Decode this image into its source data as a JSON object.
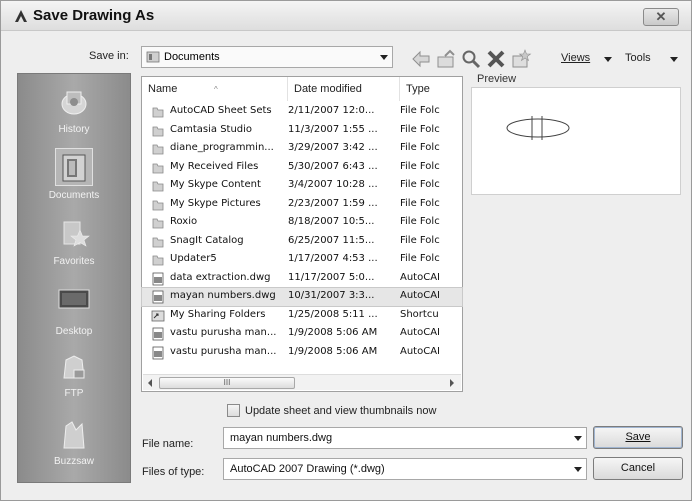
{
  "window": {
    "title": "Save Drawing As",
    "close_icon": "close-icon"
  },
  "toolbar": {
    "save_in_label": "Save in:",
    "save_in_value": "Documents",
    "icons": [
      "back-arrow-icon",
      "up-folder-icon",
      "search-icon",
      "delete-icon",
      "new-folder-icon"
    ],
    "views_label": "Views",
    "tools_label": "Tools"
  },
  "places": [
    {
      "label": "History",
      "icon": "history-icon"
    },
    {
      "label": "Documents",
      "icon": "documents-icon"
    },
    {
      "label": "Favorites",
      "icon": "favorites-icon"
    },
    {
      "label": "Desktop",
      "icon": "desktop-icon"
    },
    {
      "label": "FTP",
      "icon": "ftp-icon"
    },
    {
      "label": "Buzzsaw",
      "icon": "buzzsaw-icon"
    }
  ],
  "filelist": {
    "columns": [
      "Name",
      "Date modified",
      "Type"
    ],
    "rows": [
      {
        "name": "AutoCAD Sheet Sets",
        "date": "2/11/2007 12:0...",
        "type": "File Folc",
        "icon": "folder-icon"
      },
      {
        "name": "Camtasia Studio",
        "date": "11/3/2007 1:55 ...",
        "type": "File Folc",
        "icon": "folder-icon"
      },
      {
        "name": "diane_programmin...",
        "date": "3/29/2007 3:42 ...",
        "type": "File Folc",
        "icon": "folder-icon"
      },
      {
        "name": "My Received Files",
        "date": "5/30/2007 6:43 ...",
        "type": "File Folc",
        "icon": "folder-icon"
      },
      {
        "name": "My Skype Content",
        "date": "3/4/2007 10:28 ...",
        "type": "File Folc",
        "icon": "folder-icon"
      },
      {
        "name": "My Skype Pictures",
        "date": "2/23/2007 1:59 ...",
        "type": "File Folc",
        "icon": "folder-icon"
      },
      {
        "name": "Roxio",
        "date": "8/18/2007 10:5...",
        "type": "File Folc",
        "icon": "folder-icon"
      },
      {
        "name": "SnagIt Catalog",
        "date": "6/25/2007 11:5...",
        "type": "File Folc",
        "icon": "folder-icon"
      },
      {
        "name": "Updater5",
        "date": "1/17/2007 4:53 ...",
        "type": "File Folc",
        "icon": "folder-icon"
      },
      {
        "name": "data extraction.dwg",
        "date": "11/17/2007 5:0...",
        "type": "AutoCAI",
        "icon": "dwg-file-icon"
      },
      {
        "name": "mayan numbers.dwg",
        "date": "10/31/2007 3:3...",
        "type": "AutoCAI",
        "icon": "dwg-file-icon",
        "selected": true
      },
      {
        "name": "My Sharing Folders",
        "date": "1/25/2008 5:11 ...",
        "type": "Shortcu",
        "icon": "shortcut-icon"
      },
      {
        "name": "vastu purusha man...",
        "date": "1/9/2008 5:06 AM",
        "type": "AutoCAI",
        "icon": "dwg-file-icon"
      },
      {
        "name": "vastu purusha man...",
        "date": "1/9/2008 5:06 AM",
        "type": "AutoCAI",
        "icon": "dwg-file-icon"
      }
    ],
    "scroll_thumb_label": "III"
  },
  "preview": {
    "label": "Preview"
  },
  "options": {
    "update_thumbnails_label": "Update sheet and view thumbnails now",
    "update_thumbnails_checked": false
  },
  "filename": {
    "label": "File name:",
    "value": "mayan numbers.dwg"
  },
  "filetype": {
    "label": "Files of type:",
    "value": "AutoCAD 2007 Drawing (*.dwg)"
  },
  "buttons": {
    "save_label": "Save",
    "cancel_label": "Cancel"
  }
}
